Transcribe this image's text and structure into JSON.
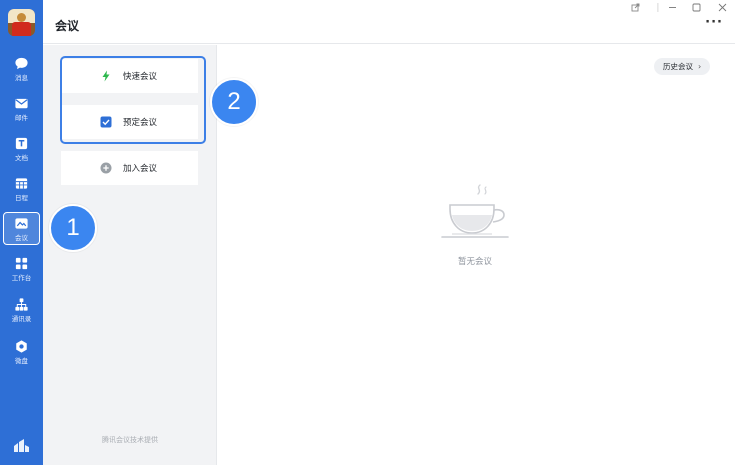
{
  "header": {
    "title": "会议"
  },
  "sidebar": {
    "items": [
      {
        "label": "消息",
        "icon": "chat-icon"
      },
      {
        "label": "邮件",
        "icon": "mail-icon"
      },
      {
        "label": "文档",
        "icon": "document-icon"
      },
      {
        "label": "日程",
        "icon": "calendar-icon"
      },
      {
        "label": "会议",
        "icon": "meeting-icon",
        "active": true
      },
      {
        "label": "工作台",
        "icon": "workbench-icon"
      },
      {
        "label": "通讯录",
        "icon": "contacts-icon"
      },
      {
        "label": "微盘",
        "icon": "drive-icon"
      }
    ],
    "bottom_icon": "settings-icon"
  },
  "meeting_actions": {
    "quick": {
      "label": "快速会议",
      "icon": "lightning-icon",
      "color": "#2db84d"
    },
    "schedule": {
      "label": "预定会议",
      "icon": "checkbox-icon",
      "color": "#2e6fd6"
    },
    "join": {
      "label": "加入会议",
      "icon": "plus-circle-icon",
      "color": "#9aa0a6"
    }
  },
  "footer_note": "腾讯会议技术提供",
  "main": {
    "history_button": "历史会议",
    "empty_text": "暂无会议"
  },
  "callouts": [
    "1",
    "2"
  ],
  "colors": {
    "rail": "#2e6fd6",
    "accent": "#3d7fe6",
    "badge": "#3b86f0"
  }
}
